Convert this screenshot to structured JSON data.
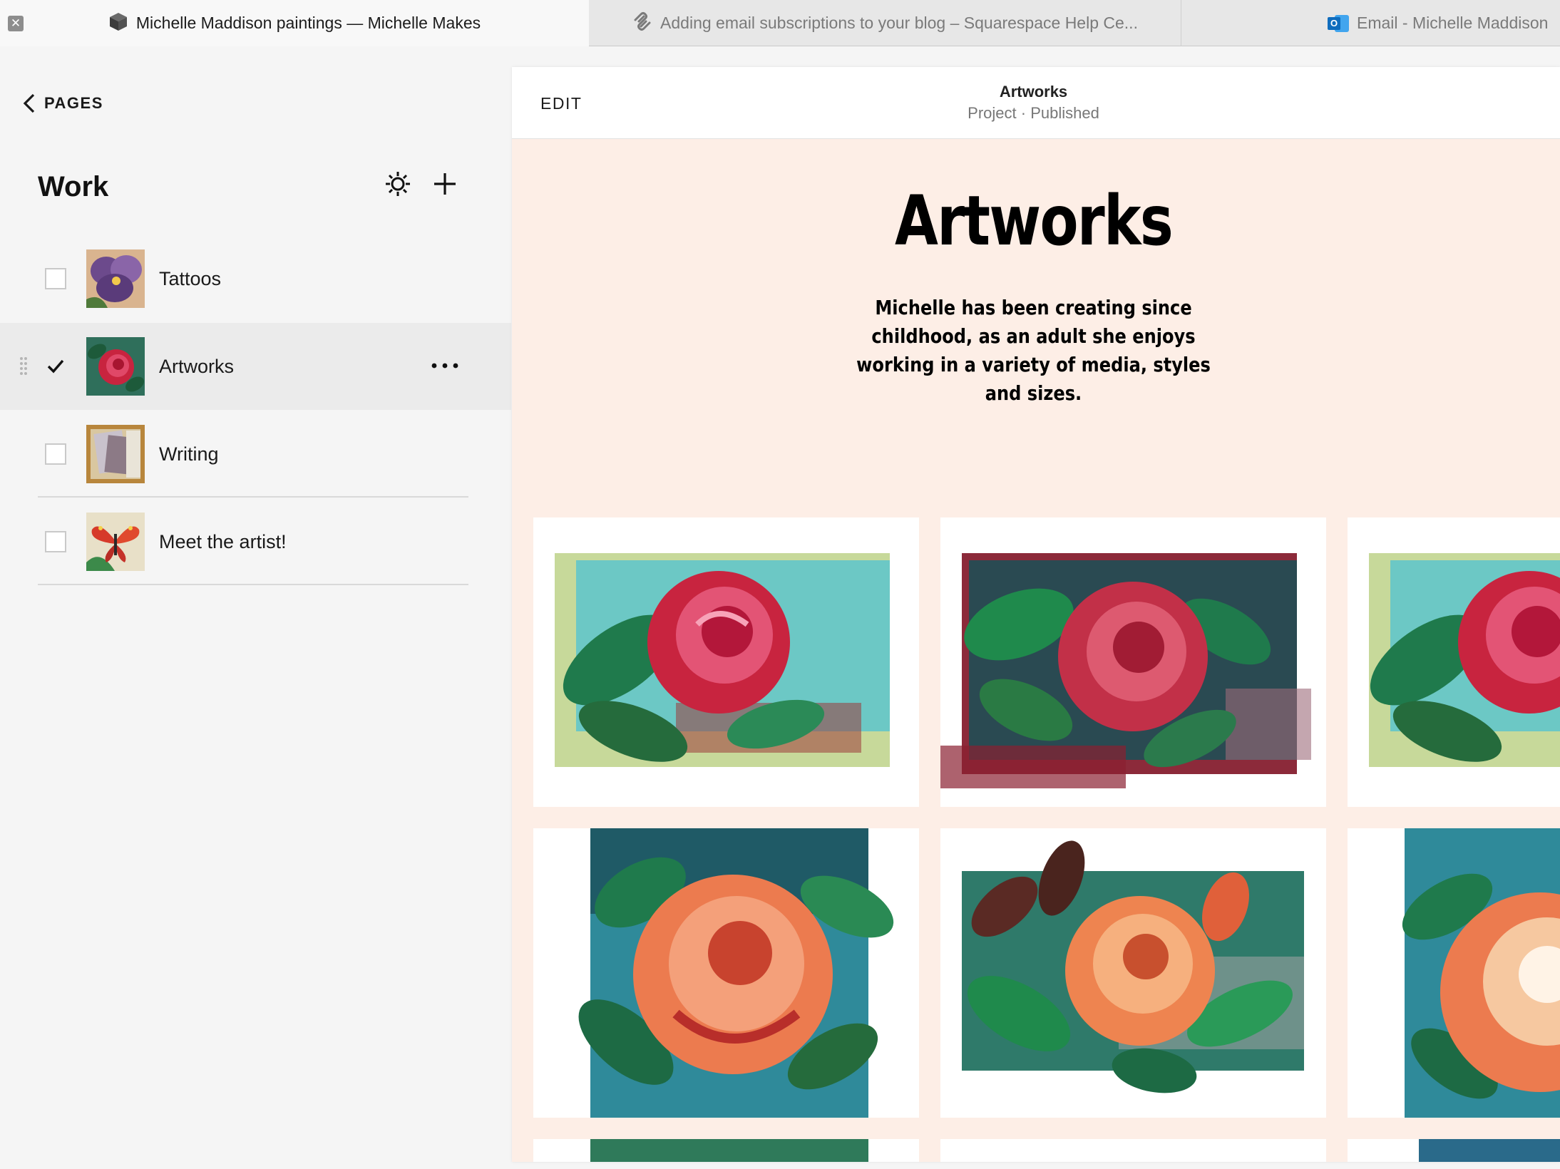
{
  "browser": {
    "tabs": [
      {
        "title": "Michelle Maddison paintings — Michelle Makes",
        "active": true,
        "icon": "cube-icon"
      },
      {
        "title": "Adding email subscriptions to your blog – Squarespace Help Ce...",
        "active": false,
        "icon": "squarespace-icon"
      },
      {
        "title": "Email - Michelle Maddison",
        "active": false,
        "icon": "outlook-icon"
      }
    ],
    "close_glyph": "✕"
  },
  "sidebar": {
    "back_label": "PAGES",
    "section_title": "Work",
    "pages": [
      {
        "label": "Tattoos",
        "checked": false,
        "selected": false,
        "thumb": "pansy-thumbnail"
      },
      {
        "label": "Artworks",
        "checked": true,
        "selected": true,
        "thumb": "rose-thumbnail"
      },
      {
        "label": "Writing",
        "checked": false,
        "selected": false,
        "thumb": "notebook-thumbnail"
      },
      {
        "label": "Meet the artist!",
        "checked": false,
        "selected": false,
        "thumb": "butterfly-thumbnail"
      }
    ]
  },
  "preview": {
    "edit_label": "EDIT",
    "page_name": "Artworks",
    "page_status": "Project · Published",
    "hero_title": "Artworks",
    "hero_description": "Michelle has been creating since childhood, as an adult she enjoys working in a variety of media, styles and sizes."
  },
  "colors": {
    "preview_background": "#fdeee6",
    "sidebar_background": "#f5f5f5",
    "selected_row": "#ebebeb",
    "rose_red": "#c8243f",
    "rose_orange": "#ec7b4f",
    "leaf_green": "#1f7a4c",
    "teal_wash": "#5cc4cc"
  }
}
